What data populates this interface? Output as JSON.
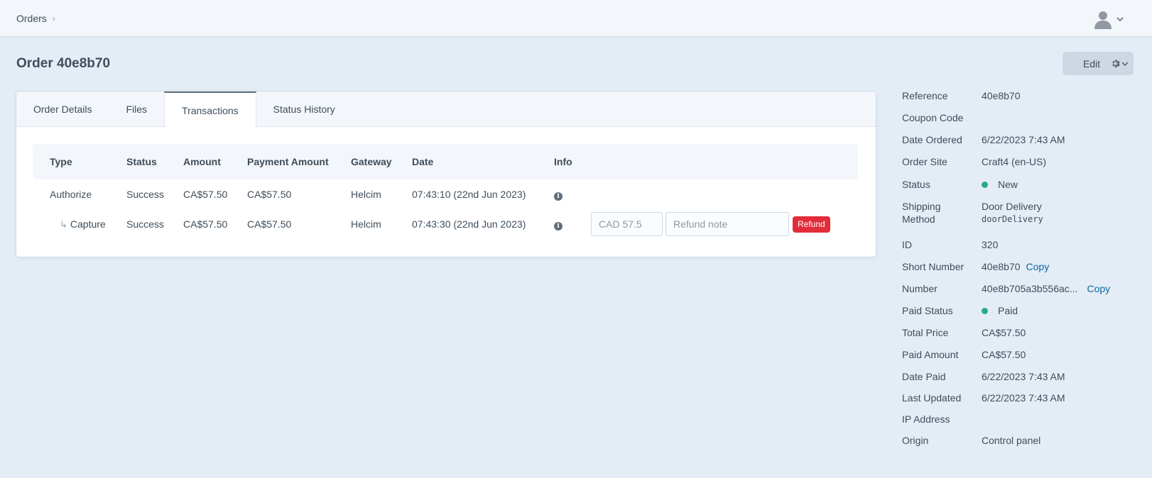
{
  "header": {
    "breadcrumb": "Orders",
    "breadcrumb_sep": "›"
  },
  "page": {
    "title": "Order 40e8b70",
    "edit_label": "Edit"
  },
  "tabs": [
    {
      "label": "Order Details"
    },
    {
      "label": "Files"
    },
    {
      "label": "Transactions",
      "active": true
    },
    {
      "label": "Status History"
    }
  ],
  "transactions": {
    "columns": [
      "Type",
      "Status",
      "Amount",
      "Payment Amount",
      "Gateway",
      "Date",
      "Info"
    ],
    "rows": [
      {
        "type": "Authorize",
        "status": "Success",
        "amount": "CA$57.50",
        "payment_amount": "CA$57.50",
        "gateway": "Helcim",
        "date": "07:43:10 (22nd Jun 2023)"
      },
      {
        "type": "Capture",
        "status": "Success",
        "amount": "CA$57.50",
        "payment_amount": "CA$57.50",
        "gateway": "Helcim",
        "date": "07:43:30 (22nd Jun 2023)"
      }
    ],
    "refund": {
      "amount_placeholder": "CAD 57.5",
      "note_placeholder": "Refund note",
      "button_label": "Refund"
    }
  },
  "meta": {
    "reference": {
      "label": "Reference",
      "value": "40e8b70"
    },
    "coupon": {
      "label": "Coupon Code",
      "value": ""
    },
    "date_ordered": {
      "label": "Date Ordered",
      "value": "6/22/2023 7:43 AM"
    },
    "order_site": {
      "label": "Order Site",
      "value": "Craft4 (en-US)"
    },
    "status": {
      "label": "Status",
      "value": "New",
      "color": "#27ab83"
    },
    "shipping_label_1": "Shipping",
    "shipping_label_2": "Method",
    "shipping_name": "Door Delivery",
    "shipping_handle": "doorDelivery",
    "id": {
      "label": "ID",
      "value": "320"
    },
    "short_number": {
      "label": "Short Number",
      "value": "40e8b70"
    },
    "number": {
      "label": "Number",
      "value": "40e8b705a3b556ac..."
    },
    "copy_label": "Copy",
    "paid_status": {
      "label": "Paid Status",
      "value": "Paid",
      "color": "#27ab83"
    },
    "total_price": {
      "label": "Total Price",
      "value": "CA$57.50"
    },
    "paid_amount": {
      "label": "Paid Amount",
      "value": "CA$57.50"
    },
    "date_paid": {
      "label": "Date Paid",
      "value": "6/22/2023 7:43 AM"
    },
    "last_updated": {
      "label": "Last Updated",
      "value": "6/22/2023 7:43 AM"
    },
    "ip_address": {
      "label": "IP Address",
      "value": ""
    },
    "origin": {
      "label": "Origin",
      "value": "Control panel"
    }
  },
  "icons": [
    "chevron-right-icon",
    "user-avatar-icon",
    "chevron-down-icon",
    "gear-icon",
    "info-icon",
    "sub-row-arrow-icon"
  ]
}
